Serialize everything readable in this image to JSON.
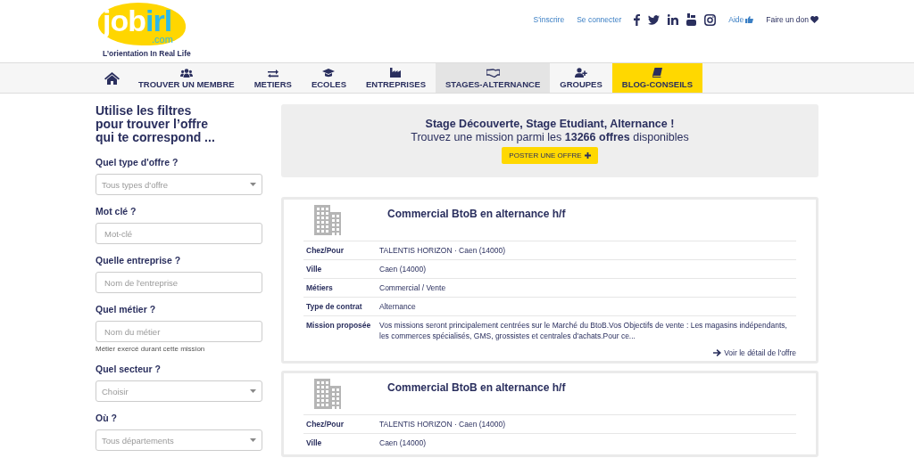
{
  "logo": {
    "name_a": "job",
    "name_b": "irl",
    "domain": ".com",
    "tagline": "L’orientation In Real Life"
  },
  "top_links": [
    {
      "label": "S'inscrire",
      "kind": "link"
    },
    {
      "label": "Se connecter",
      "kind": "link"
    }
  ],
  "social": [
    {
      "kind": "facebook"
    },
    {
      "kind": "twitter"
    },
    {
      "kind": "linkedin"
    },
    {
      "kind": "youtube"
    },
    {
      "kind": "instagram"
    }
  ],
  "help": {
    "label": "Aide"
  },
  "donate": {
    "label": "Faire un don"
  },
  "nav": [
    {
      "kind": "home",
      "selected": false,
      "highlighted": false
    },
    {
      "label": "TROUVER UN MEMBRE",
      "kind": "people",
      "selected": false,
      "highlighted": false
    },
    {
      "label": "METIERS",
      "kind": "arrows",
      "selected": false,
      "highlighted": false
    },
    {
      "label": "ECOLES",
      "kind": "cap",
      "selected": false,
      "highlighted": false
    },
    {
      "label": "ENTREPRISES",
      "kind": "factory",
      "selected": false,
      "highlighted": false
    },
    {
      "label": "STAGES-ALTERNANCE",
      "kind": "handshake",
      "selected": true,
      "highlighted": false
    },
    {
      "label": "GROUPES",
      "kind": "useradd",
      "selected": false,
      "highlighted": false
    },
    {
      "label": "BLOG-CONSEILS",
      "kind": "book",
      "selected": false,
      "highlighted": true
    }
  ],
  "filters": {
    "title": "Utilise les filtres pour trouver l’offre qui te correspond ...",
    "items": [
      {
        "label": "Quel type d'offre ?",
        "kind": "select",
        "placeholder": "Tous types d'offre"
      },
      {
        "label": "Mot clé ?",
        "kind": "input",
        "placeholder": "Mot-clé"
      },
      {
        "label": "Quelle entreprise ?",
        "kind": "input",
        "placeholder": "Nom de l'entreprise"
      },
      {
        "label": "Quel métier ?",
        "kind": "input",
        "placeholder": "Nom du métier",
        "hint": "Métier exercé durant cette mission"
      },
      {
        "label": "Quel secteur ?",
        "kind": "select",
        "placeholder": "Choisir"
      },
      {
        "label": "Où ?",
        "kind": "select",
        "placeholder": "Tous départements"
      }
    ]
  },
  "banner": {
    "line1": "Stage Découverte, Stage Etudiant, Alternance !",
    "line2": "Trouvez une mission parmi les **13266 offres** disponibles",
    "button": "POSTER UNE OFFRE"
  },
  "offers": [
    {
      "title": "Commercial BtoB en alternance h/f",
      "rows": [
        {
          "label": "Chez/Pour",
          "value": "TALENTIS HORIZON · Caen (14000)"
        },
        {
          "label": "Ville",
          "value": "Caen (14000)"
        },
        {
          "label": "Métiers",
          "value": "Commercial / Vente"
        },
        {
          "label": "Type de contrat",
          "value": "Alternance"
        },
        {
          "label": "Mission proposée",
          "value": "Vos missions seront principalement centrées sur le Marché du BtoB.Vos Objectifs de vente : Les magasins indépendants, les commerces spécialisés, GMS, grossistes et centrales d'achats.Pour ce..."
        }
      ],
      "link": "Voir le détail de l'offre"
    },
    {
      "title": "Commercial BtoB en alternance h/f",
      "rows": [
        {
          "label": "Chez/Pour",
          "value": "TALENTIS HORIZON · Caen (14000)"
        },
        {
          "label": "Ville",
          "value": "Caen (14000)"
        }
      ]
    }
  ]
}
